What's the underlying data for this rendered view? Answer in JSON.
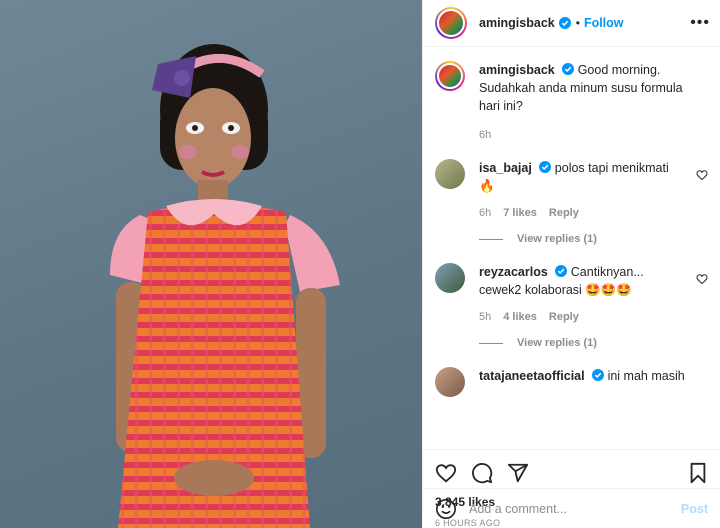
{
  "post": {
    "author": "amingisback",
    "follow_label": "Follow",
    "dot": "•",
    "more": "•••",
    "caption": "Good morning. Sudahkah anda minum susu formula hari ini?",
    "caption_time": "6h"
  },
  "comments": [
    {
      "user": "isa_bajaj",
      "text": "polos tapi menikmati 🔥",
      "time": "6h",
      "likes": "7 likes",
      "reply": "Reply",
      "view_replies": "View replies (1)"
    },
    {
      "user": "reyzacarlos",
      "text": "Cantiknyan... cewek2 kolaborasi 🤩🤩🤩",
      "time": "5h",
      "likes": "4 likes",
      "reply": "Reply",
      "view_replies": "View replies (1)"
    },
    {
      "user": "tatajaneetaofficial",
      "text": "ini mah masih"
    }
  ],
  "footer": {
    "likes": "3,845 likes",
    "time_ago": "6 HOURS AGO",
    "comment_placeholder": "Add a comment...",
    "post_label": "Post"
  },
  "icons": {
    "verified": "verified-badge-icon",
    "like": "heart-icon",
    "comment": "comment-icon",
    "share": "paper-plane-icon",
    "save": "bookmark-icon",
    "emoji": "smiley-icon"
  },
  "colors": {
    "accent": "#0095f6",
    "post_disabled": "#b3dbff",
    "muted": "#8e8e8e"
  }
}
